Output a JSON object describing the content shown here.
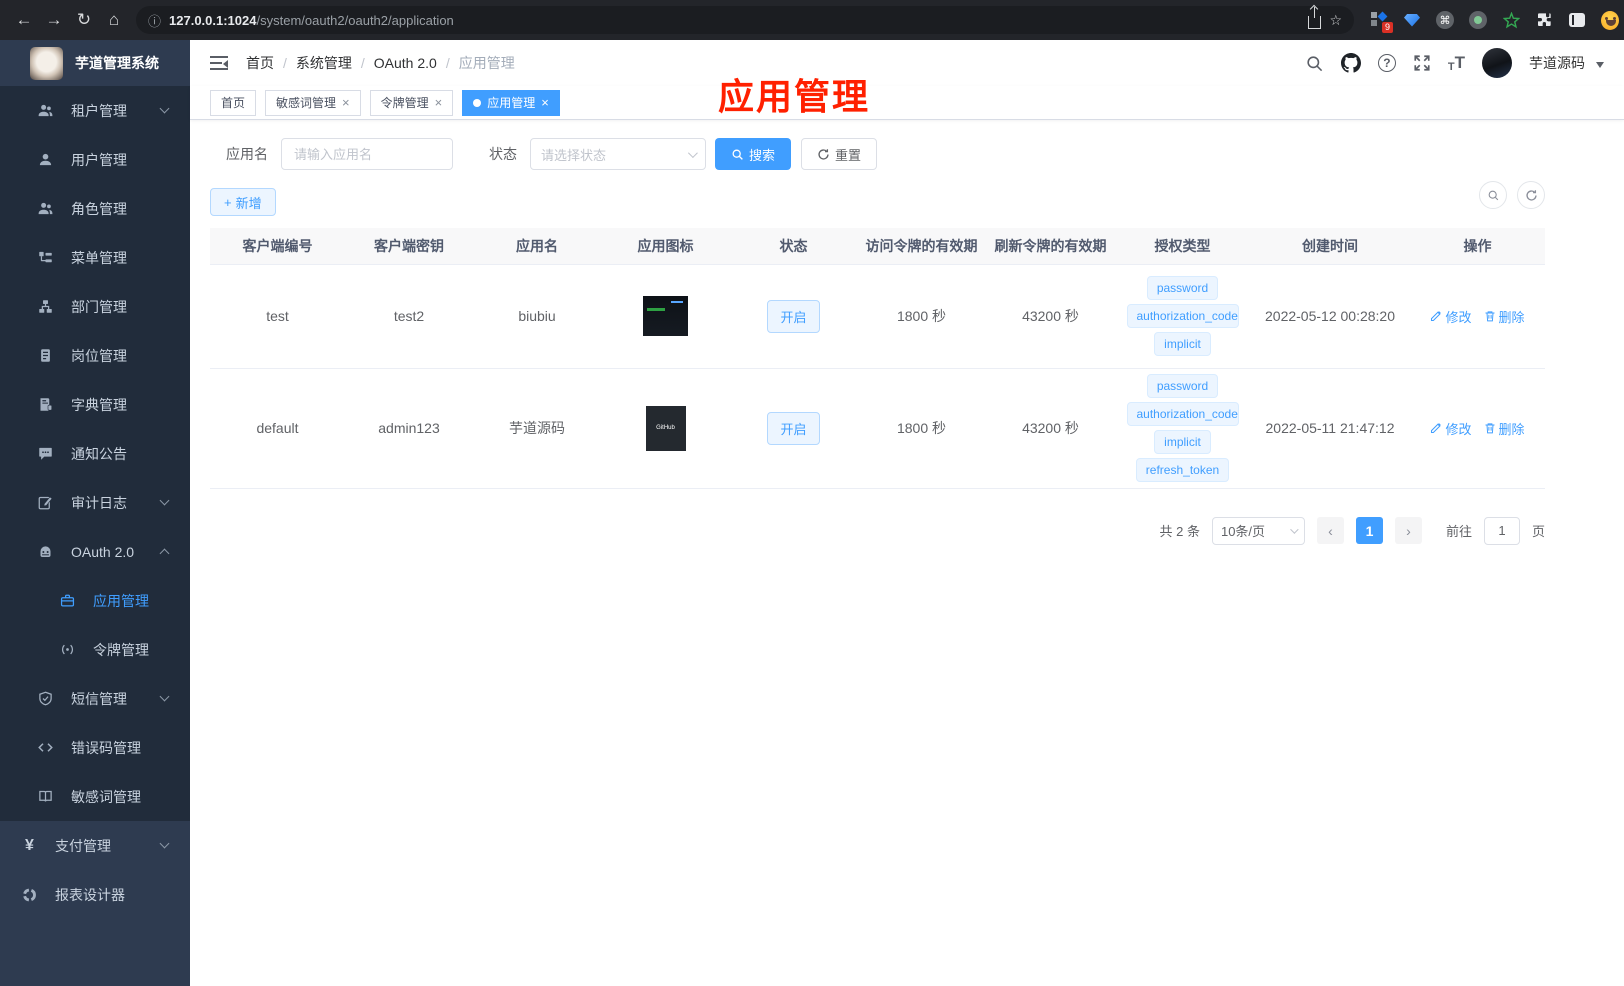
{
  "glyphs": {
    "back": "←",
    "forward": "→",
    "reload": "↻",
    "home": "⌂",
    "info": "ⓘ",
    "star": "☆",
    "dots": "⋮",
    "cmd": "⌘",
    "close": "×",
    "slash": "/",
    "question": "?",
    "t": "T",
    "plus": "+",
    "chev_left": "‹",
    "chev_right": "›",
    "yen": "¥"
  },
  "browser": {
    "url_host": "127.0.0.1:1024",
    "url_path": "/system/oauth2/oauth2/application",
    "extension_badge": "9"
  },
  "annotation": {
    "text": "应用管理",
    "color": "#ff2000"
  },
  "sidebar": {
    "logo_title": "芋道管理系统",
    "menu": [
      {
        "label": "租户管理",
        "icon": "users-icon",
        "arrow": "down"
      },
      {
        "label": "用户管理",
        "icon": "user-icon"
      },
      {
        "label": "角色管理",
        "icon": "users-icon"
      },
      {
        "label": "菜单管理",
        "icon": "menu-tree-icon"
      },
      {
        "label": "部门管理",
        "icon": "org-tree-icon"
      },
      {
        "label": "岗位管理",
        "icon": "id-card-icon"
      },
      {
        "label": "字典管理",
        "icon": "dictionary-icon"
      },
      {
        "label": "通知公告",
        "icon": "message-icon"
      },
      {
        "label": "审计日志",
        "icon": "edit-log-icon",
        "arrow": "down"
      },
      {
        "label": "OAuth 2.0",
        "icon": "robot-icon",
        "arrow": "up"
      },
      {
        "label": "应用管理",
        "icon": "briefcase-icon",
        "active": true,
        "sub": true
      },
      {
        "label": "令牌管理",
        "icon": "signal-icon",
        "sub": true
      },
      {
        "label": "短信管理",
        "icon": "shield-icon",
        "arrow": "down"
      },
      {
        "label": "错误码管理",
        "icon": "code-icon"
      },
      {
        "label": "敏感词管理",
        "icon": "open-book-icon"
      }
    ],
    "bottom_menu": [
      {
        "label": "支付管理",
        "icon": "yen-icon",
        "arrow": "down"
      },
      {
        "label": "报表设计器",
        "icon": "report-icon"
      }
    ]
  },
  "header": {
    "breadcrumb": [
      "首页",
      "系统管理",
      "OAuth 2.0",
      "应用管理"
    ],
    "username": "芋道源码"
  },
  "tabs": [
    {
      "label": "首页"
    },
    {
      "label": "敏感词管理",
      "closable": true
    },
    {
      "label": "令牌管理",
      "closable": true
    },
    {
      "label": "应用管理",
      "closable": true,
      "active": true
    }
  ],
  "filter": {
    "name_label": "应用名",
    "name_placeholder": "请输入应用名",
    "status_label": "状态",
    "status_placeholder": "请选择状态",
    "search_label": "搜索",
    "reset_label": "重置"
  },
  "toolbar": {
    "add_label": "新增"
  },
  "table": {
    "columns": [
      "客户端编号",
      "客户端密钥",
      "应用名",
      "应用图标",
      "状态",
      "访问令牌的有效期",
      "刷新令牌的有效期",
      "授权类型",
      "创建时间",
      "操作"
    ],
    "rows": [
      {
        "client_id": "test",
        "secret": "test2",
        "name": "biubiu",
        "icon_text": "",
        "status": "开启",
        "access_ttl": "1800 秒",
        "refresh_ttl": "43200 秒",
        "grants": [
          "password",
          "authorization_code",
          "implicit"
        ],
        "created": "2022-05-12 00:28:20",
        "edit": "修改",
        "delete": "删除"
      },
      {
        "client_id": "default",
        "secret": "admin123",
        "name": "芋道源码",
        "icon_text": "GitHub",
        "status": "开启",
        "access_ttl": "1800 秒",
        "refresh_ttl": "43200 秒",
        "grants": [
          "password",
          "authorization_code",
          "implicit",
          "refresh_token"
        ],
        "created": "2022-05-11 21:47:12",
        "edit": "修改",
        "delete": "删除"
      }
    ]
  },
  "pagination": {
    "total": "共 2 条",
    "page_size": "10条/页",
    "current_page": "1",
    "goto_label": "前往",
    "goto_value": "1",
    "page_suffix": "页"
  },
  "colors": {
    "accent": "#409eff",
    "sidebar_dark": "#212c3b",
    "sidebar_light": "#2e3b50",
    "annotation_red": "#ff2000"
  }
}
